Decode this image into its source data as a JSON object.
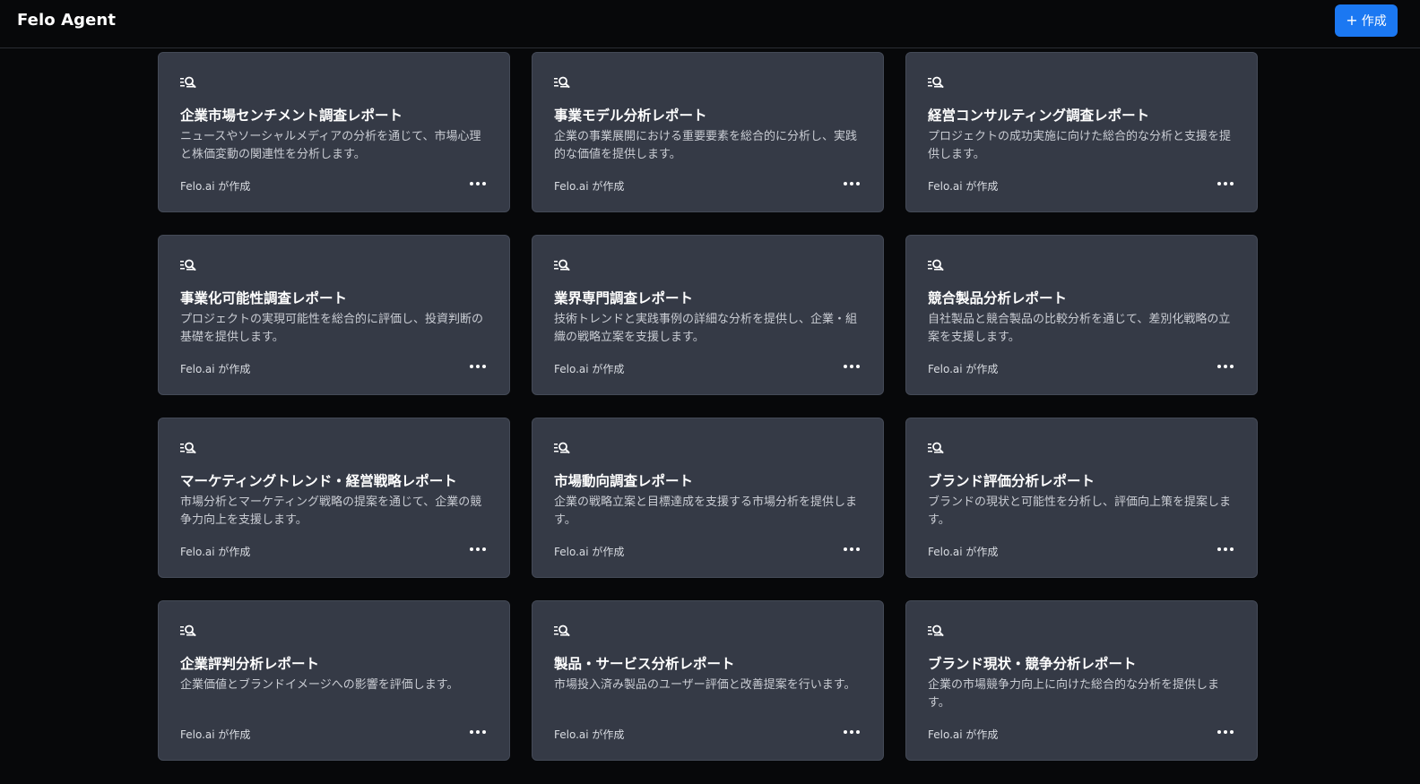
{
  "app": {
    "title": "Felo Agent"
  },
  "header": {
    "create_button": {
      "icon": "plus-icon",
      "label": "作成",
      "color": "#1b78f2"
    }
  },
  "cards": [
    {
      "icon": "report-search-icon",
      "title": "企業市場センチメント調査レポート",
      "description": "ニュースやソーシャルメディアの分析を通じて、市場心理と株価変動の関連性を分析します。",
      "author": "Felo.ai が作成"
    },
    {
      "icon": "report-search-icon",
      "title": "事業モデル分析レポート",
      "description": "企業の事業展開における重要要素を総合的に分析し、実践的な価値を提供します。",
      "author": "Felo.ai が作成"
    },
    {
      "icon": "report-search-icon",
      "title": "経営コンサルティング調査レポート",
      "description": "プロジェクトの成功実施に向けた総合的な分析と支援を提供します。",
      "author": "Felo.ai が作成"
    },
    {
      "icon": "report-search-icon",
      "title": "事業化可能性調査レポート",
      "description": "プロジェクトの実現可能性を総合的に評価し、投資判断の基礎を提供します。",
      "author": "Felo.ai が作成"
    },
    {
      "icon": "report-search-icon",
      "title": "業界専門調査レポート",
      "description": "技術トレンドと実践事例の詳細な分析を提供し、企業・組織の戦略立案を支援します。",
      "author": "Felo.ai が作成"
    },
    {
      "icon": "report-search-icon",
      "title": "競合製品分析レポート",
      "description": "自社製品と競合製品の比較分析を通じて、差別化戦略の立案を支援します。",
      "author": "Felo.ai が作成"
    },
    {
      "icon": "report-search-icon",
      "title": "マーケティングトレンド・経営戦略レポート",
      "description": "市場分析とマーケティング戦略の提案を通じて、企業の競争力向上を支援します。",
      "author": "Felo.ai が作成"
    },
    {
      "icon": "report-search-icon",
      "title": "市場動向調査レポート",
      "description": "企業の戦略立案と目標達成を支援する市場分析を提供します。",
      "author": "Felo.ai が作成"
    },
    {
      "icon": "report-search-icon",
      "title": "ブランド評価分析レポート",
      "description": "ブランドの現状と可能性を分析し、評価向上策を提案します。",
      "author": "Felo.ai が作成"
    },
    {
      "icon": "report-search-icon",
      "title": "企業評判分析レポート",
      "description": "企業価値とブランドイメージへの影響を評価します。",
      "author": "Felo.ai が作成"
    },
    {
      "icon": "report-search-icon",
      "title": "製品・サービス分析レポート",
      "description": "市場投入済み製品のユーザー評価と改善提案を行います。",
      "author": "Felo.ai が作成"
    },
    {
      "icon": "report-search-icon",
      "title": "ブランド現状・競争分析レポート",
      "description": "企業の市場競争力向上に向けた総合的な分析を提供します。",
      "author": "Felo.ai が作成"
    }
  ]
}
